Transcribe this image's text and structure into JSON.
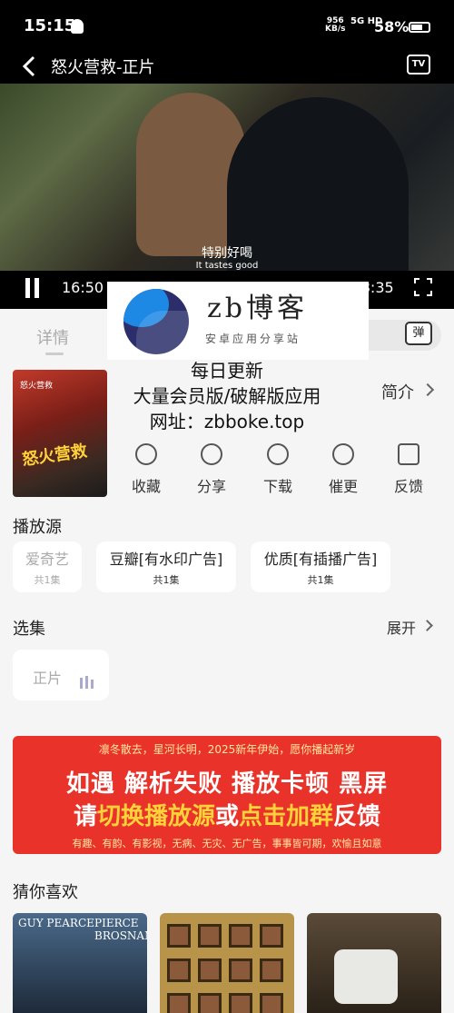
{
  "status": {
    "time": "15:15",
    "net_speed": "956",
    "net_unit": "KB/s",
    "signal": "5G HD",
    "battery": "58%"
  },
  "header": {
    "title": "怒火营救-正片",
    "tv_label": "TV"
  },
  "player": {
    "subtitle_cn": "特别好喝",
    "subtitle_en": "It tastes good",
    "current_time": "16:50",
    "duration": "1:38:35",
    "progress": 0.171
  },
  "tabs": {
    "details": "详情",
    "danmu_button": "弹"
  },
  "watermark": {
    "brand": "zb博客",
    "slogan": "安卓应用分享站"
  },
  "promo": {
    "line1": "每日更新",
    "line2": "大量会员版/破解版应用",
    "line3": "网址：zbboke.top"
  },
  "info": {
    "intro_label": "简介"
  },
  "poster": {
    "title": "怒火营救",
    "small": "怒火营救 "
  },
  "actions": [
    {
      "label": "收藏",
      "icon": "heart-icon"
    },
    {
      "label": "分享",
      "icon": "share-icon"
    },
    {
      "label": "下载",
      "icon": "download-icon"
    },
    {
      "label": "催更",
      "icon": "bell-icon"
    },
    {
      "label": "反馈",
      "icon": "feedback-icon"
    }
  ],
  "sources": {
    "title": "播放源",
    "items": [
      {
        "name": "爱奇艺",
        "count": "共1集"
      },
      {
        "name": "豆瓣[有水印广告]",
        "count": "共1集"
      },
      {
        "name": "优质[有插播广告]",
        "count": "共1集"
      }
    ]
  },
  "episodes": {
    "title": "选集",
    "expand_label": "展开",
    "items": [
      {
        "label": "正片"
      }
    ]
  },
  "banner": {
    "top": "凛冬散去，星河长明，2025新年伊始，愿你播起新岁",
    "main": "如遇 解析失败 播放卡顿 黑屏",
    "sub_a": "请",
    "sub_b": "切换播放源",
    "sub_c": "或",
    "sub_d": "点击加群",
    "sub_e": "反馈",
    "bottom": "有趣、有韵、有影视，无病、无灾、无广告，事事皆可期，欢愉且如意"
  },
  "recommend": {
    "title": "猜你喜欢",
    "items": [
      {
        "top_left": "GUY PEARCE",
        "top_right": "PIERCE BROSNAN"
      },
      {
        "label": ""
      },
      {
        "label": ""
      }
    ]
  }
}
